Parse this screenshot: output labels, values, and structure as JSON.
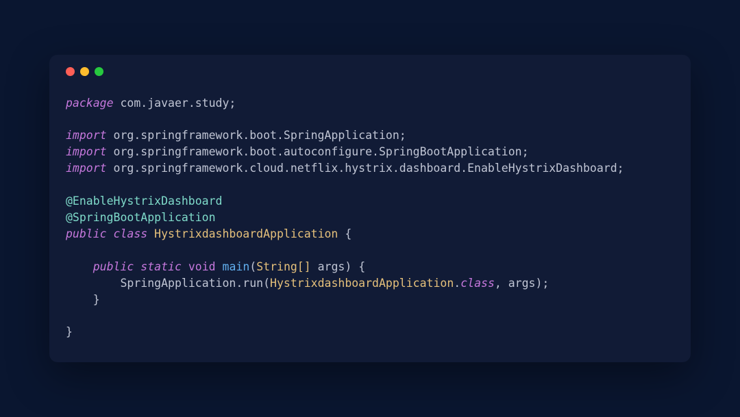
{
  "code": {
    "package_kw": "package",
    "package_path": " com.javaer.study;",
    "import_kw": "import",
    "import1": " org.springframework.boot.SpringApplication;",
    "import2": " org.springframework.boot.autoconfigure.SpringBootApplication;",
    "import3": " org.springframework.cloud.netflix.hystrix.dashboard.EnableHystrixDashboard;",
    "annotation1": "@EnableHystrixDashboard",
    "annotation2": "@SpringBootApplication",
    "public_kw": "public",
    "class_kw": "class",
    "class_name": " HystrixdashboardApplication ",
    "open_brace": "{",
    "static_kw": "static",
    "void_kw": " void ",
    "main_method": "main",
    "main_params_open": "(",
    "string_arr": "String[] ",
    "args_param": "args",
    "main_params_close": ") {",
    "spring_app": "SpringApplication",
    "dot_run": ".run(",
    "hystrix_class": "HystrixdashboardApplication",
    "dot": ".",
    "class_literal": "class",
    "comma_args": ", args);",
    "close_brace_inner": "    }",
    "close_brace_outer": "}",
    "space": " ",
    "indent1": "    ",
    "indent2": "        "
  }
}
